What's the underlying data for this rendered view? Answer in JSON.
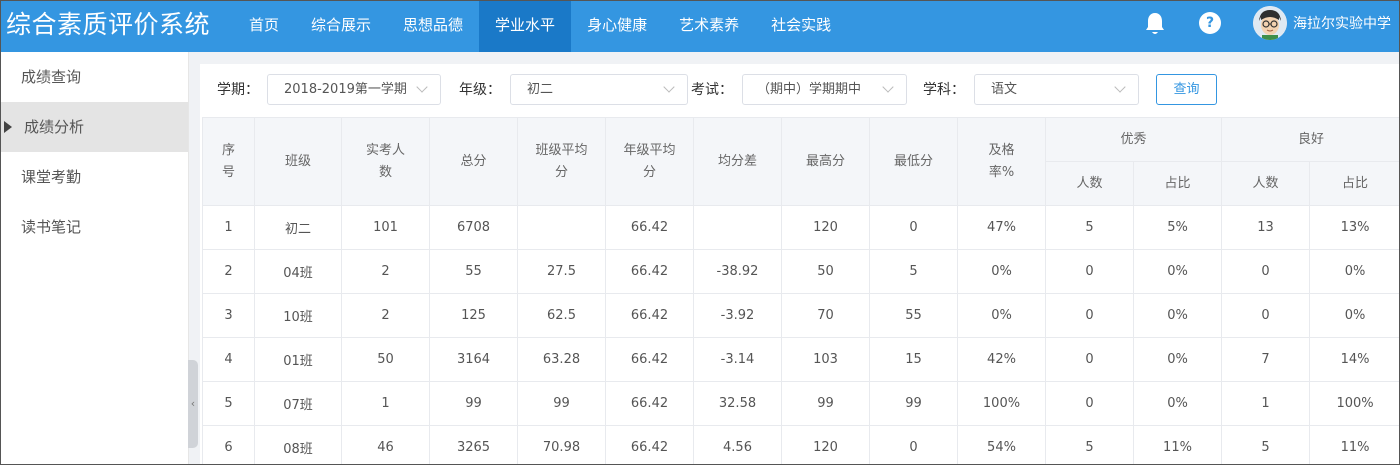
{
  "header": {
    "title": "综合素质评价系统",
    "nav": [
      "首页",
      "综合展示",
      "思想品德",
      "学业水平",
      "身心健康",
      "艺术素养",
      "社会实践"
    ],
    "active_nav": "学业水平",
    "user_name": "海拉尔实验中学",
    "help_glyph": "?",
    "icons": [
      "bell-icon",
      "help-icon",
      "avatar"
    ]
  },
  "sidebar": {
    "items": [
      "成绩查询",
      "成绩分析",
      "课堂考勤",
      "读书笔记"
    ],
    "active": "成绩分析",
    "collapse_glyph": "‹"
  },
  "filters": {
    "term_label": "学期：",
    "term_value": "2018-2019第一学期",
    "grade_label": "年级：",
    "grade_value": "初二",
    "exam_label": "考试：",
    "exam_value": "（期中）学期期中",
    "subject_label": "学科：",
    "subject_value": "语文",
    "query_label": "查询"
  },
  "table": {
    "headers": {
      "index": "序号",
      "class": "班级",
      "examinees": "实考人数",
      "total": "总分",
      "class_avg": "班级平均分",
      "grade_avg": "年级平均分",
      "avg_diff": "均分差",
      "max": "最高分",
      "min": "最低分",
      "pass_rate": "及格率%",
      "excellent": "优秀",
      "good": "良好",
      "count": "人数",
      "ratio": "占比"
    },
    "rows": [
      [
        "1",
        "初二",
        "101",
        "6708",
        "",
        "66.42",
        "",
        "120",
        "0",
        "47%",
        "5",
        "5%",
        "13",
        "13%"
      ],
      [
        "2",
        "04班",
        "2",
        "55",
        "27.5",
        "66.42",
        "-38.92",
        "50",
        "5",
        "0%",
        "0",
        "0%",
        "0",
        "0%"
      ],
      [
        "3",
        "10班",
        "2",
        "125",
        "62.5",
        "66.42",
        "-3.92",
        "70",
        "55",
        "0%",
        "0",
        "0%",
        "0",
        "0%"
      ],
      [
        "4",
        "01班",
        "50",
        "3164",
        "63.28",
        "66.42",
        "-3.14",
        "103",
        "15",
        "42%",
        "0",
        "0%",
        "7",
        "14%"
      ],
      [
        "5",
        "07班",
        "1",
        "99",
        "99",
        "66.42",
        "32.58",
        "99",
        "99",
        "100%",
        "0",
        "0%",
        "1",
        "100%"
      ],
      [
        "6",
        "08班",
        "46",
        "3265",
        "70.98",
        "66.42",
        "4.56",
        "120",
        "0",
        "54%",
        "5",
        "11%",
        "5",
        "11%"
      ]
    ]
  },
  "colors": {
    "header_bg": "#3496e1",
    "nav_active_bg": "#1a79c8",
    "accent": "#3496e1"
  }
}
